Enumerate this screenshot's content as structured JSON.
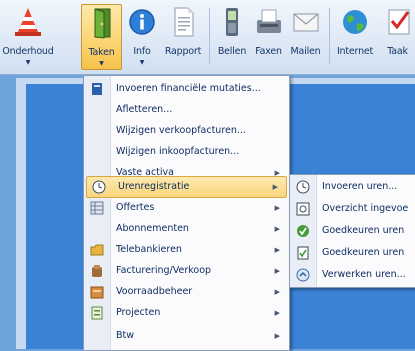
{
  "ribbon": {
    "buttons": [
      {
        "label": "Onderhoud",
        "icon": "traffic-cone-icon"
      },
      {
        "label": "Taken",
        "icon": "door-icon"
      },
      {
        "label": "Info",
        "icon": "info-icon"
      },
      {
        "label": "Rapport",
        "icon": "document-icon"
      },
      {
        "label": "Bellen",
        "icon": "phone-icon"
      },
      {
        "label": "Faxen",
        "icon": "fax-icon"
      },
      {
        "label": "Mailen",
        "icon": "mail-icon"
      },
      {
        "label": "Internet",
        "icon": "globe-icon"
      },
      {
        "label": "Taak",
        "icon": "task-icon"
      }
    ]
  },
  "menu": {
    "items": [
      {
        "label": "Invoeren financiële mutaties...",
        "icon": "book-icon",
        "submenu": false
      },
      {
        "label": "Afletteren...",
        "icon": "",
        "submenu": false
      },
      {
        "label": "Wijzigen verkoopfacturen...",
        "icon": "",
        "submenu": false
      },
      {
        "label": "Wijzigen inkoopfacturen...",
        "icon": "",
        "submenu": false
      },
      {
        "label": "Vaste activa",
        "icon": "",
        "submenu": true
      },
      {
        "label": "Urenregistratie",
        "icon": "clock-icon",
        "submenu": true
      },
      {
        "label": "Offertes",
        "icon": "grid-icon",
        "submenu": true
      },
      {
        "label": "Abonnementen",
        "icon": "",
        "submenu": true
      },
      {
        "label": "Telebankieren",
        "icon": "folder-icon",
        "submenu": true
      },
      {
        "label": "Facturering/Verkoop",
        "icon": "box-icon",
        "submenu": true
      },
      {
        "label": "Voorraadbeheer",
        "icon": "inventory-icon",
        "submenu": true
      },
      {
        "label": "Projecten",
        "icon": "project-icon",
        "submenu": true
      },
      {
        "label": "Btw",
        "icon": "",
        "submenu": true
      }
    ],
    "highlighted": "Urenregistratie"
  },
  "submenu": {
    "items": [
      {
        "label": "Invoeren uren...",
        "icon": "clock-icon"
      },
      {
        "label": "Overzicht ingevoe",
        "icon": "overview-icon"
      },
      {
        "label": "Goedkeuren uren",
        "icon": "approve-icon"
      },
      {
        "label": "Goedkeuren uren",
        "icon": "approve-doc-icon"
      },
      {
        "label": "Verwerken uren...",
        "icon": "process-icon"
      }
    ]
  },
  "colors": {
    "highlight": "#f9d57c",
    "ribbon_text": "#15356a",
    "menu_text": "#0c2a5e",
    "background": "#3a82d6"
  }
}
